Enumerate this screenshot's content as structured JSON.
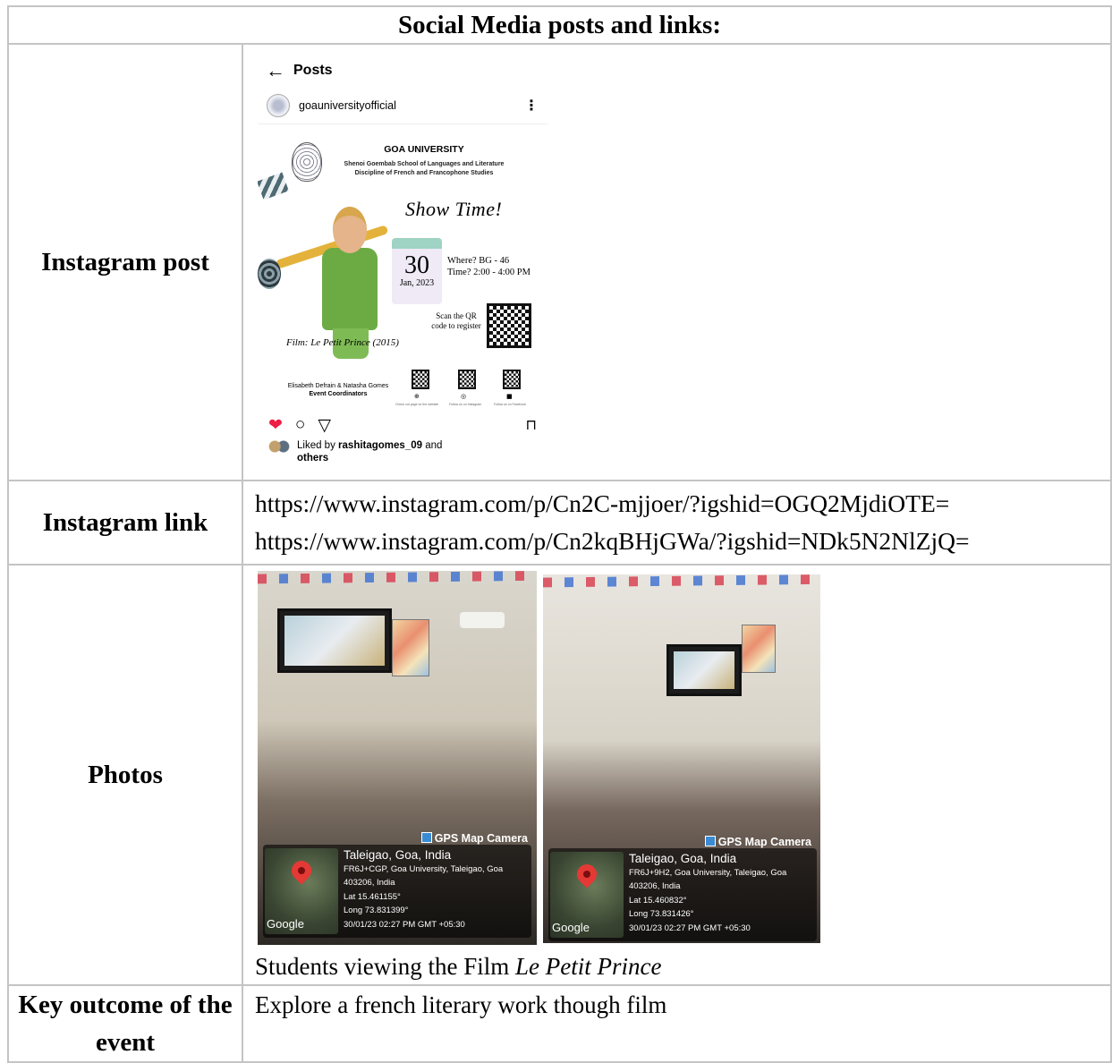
{
  "header": "Social Media posts and links:",
  "rows": {
    "instagram_post": {
      "label": "Instagram post",
      "post": {
        "back_icon": "arrow-left-icon",
        "title": "Posts",
        "username": "goauniversityofficial",
        "poster": {
          "university": "GOA UNIVERSITY",
          "school": "Shenoi Goembab School of Languages and Literature",
          "discipline": "Discipline of French and Francophone Studies",
          "headline": "Show Time!",
          "day": "30",
          "month_year": "Jan, 2023",
          "where": "Where? BG - 46",
          "time": "Time? 2:00 - 4:00 PM",
          "scan": "Scan the QR code to register",
          "film": "Film: Le Petit Prince (2015)",
          "coordinators_names": "Elisabeth Defrain & Natasha Gomes",
          "coordinators_role": "Event Coordinators",
          "qr_captions": [
            "Check out page on the website",
            "Follow us on Instagram",
            "Follow us on Facebook"
          ]
        },
        "liked_prefix": "Liked by",
        "liked_user": "rashitagomes_09",
        "liked_suffix": "and",
        "liked_others": "others",
        "colors": {
          "heart": "#ed1d43"
        }
      }
    },
    "instagram_link": {
      "label": "Instagram link",
      "links": [
        "https://www.instagram.com/p/Cn2C-mjjoer/?igshid=OGQ2MjdiOTE=",
        "https://www.instagram.com/p/Cn2kqBHjGWa/?igshid=NDk5N2NlZjQ="
      ]
    },
    "photos": {
      "label": "Photos",
      "items": [
        {
          "camera": "GPS Map Camera",
          "place": "Taleigao, Goa, India",
          "address1": "FR6J+CGP, Goa University, Taleigao, Goa",
          "address2": "403206, India",
          "lat": "Lat 15.461155°",
          "long": "Long 73.831399°",
          "datetime": "30/01/23 02:27 PM GMT +05:30",
          "brand": "Google"
        },
        {
          "camera": "GPS Map Camera",
          "place": "Taleigao, Goa, India",
          "address1": "FR6J+9H2, Goa University, Taleigao, Goa",
          "address2": "403206, India",
          "lat": "Lat 15.460832°",
          "long": "Long 73.831426°",
          "datetime": "30/01/23 02:27 PM GMT +05:30",
          "brand": "Google"
        }
      ],
      "caption_prefix": "Students viewing the Film",
      "caption_title": "Le Petit Prince"
    },
    "key_outcome": {
      "label": "Key outcome of the event",
      "value": "Explore a french literary work though film"
    }
  }
}
